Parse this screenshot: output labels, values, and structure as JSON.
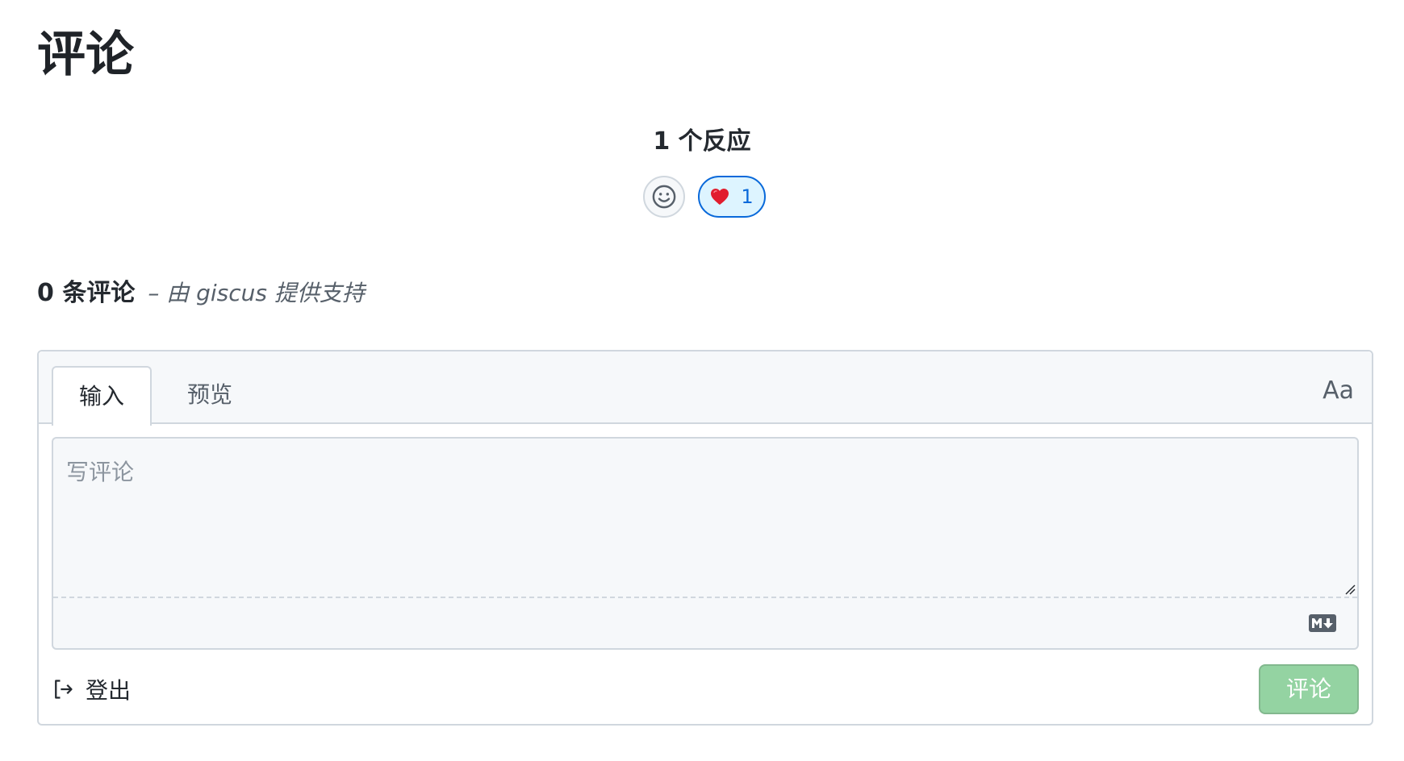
{
  "page": {
    "title": "评论"
  },
  "reactions": {
    "summary": "1 个反应",
    "picker_icon": "smiley-icon",
    "items": [
      {
        "emoji": "❤️",
        "icon": "heart-icon",
        "count": "1"
      }
    ],
    "colors": {
      "active_border": "#0969da",
      "active_bg": "#ddf4ff"
    }
  },
  "comments": {
    "count_label": "0 条评论",
    "powered_by": "– 由 giscus 提供支持"
  },
  "editor": {
    "tabs": [
      {
        "label": "输入",
        "selected": true
      },
      {
        "label": "预览",
        "selected": false
      }
    ],
    "font_toggle": "Aa",
    "placeholder": "写评论",
    "value": "",
    "markdown_icon": "markdown-icon"
  },
  "footer": {
    "signout_label": "登出",
    "signout_icon": "sign-out-icon",
    "submit_label": "评论",
    "submit_color": "#94d3a2",
    "submit_disabled": true
  }
}
